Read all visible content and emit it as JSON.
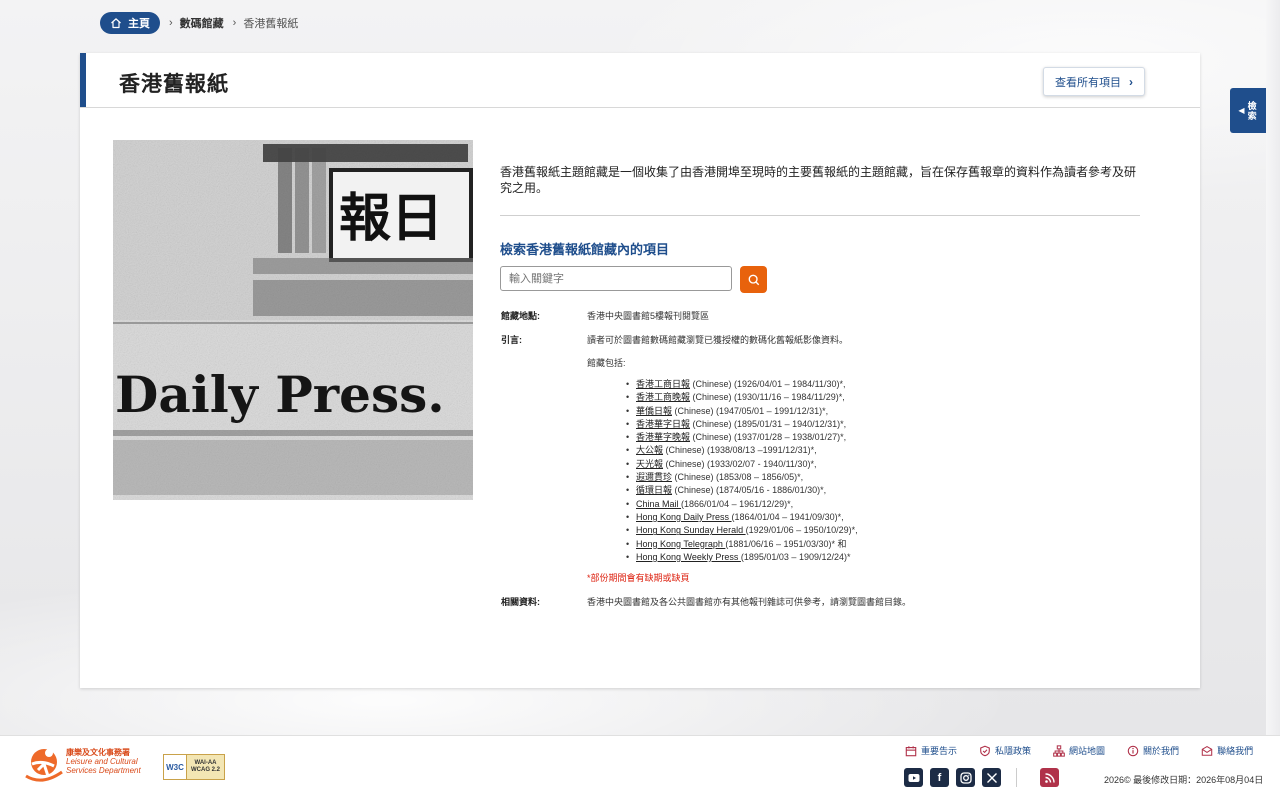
{
  "breadcrumb": {
    "home": "主頁",
    "section": "數碼館藏",
    "current": "香港舊報紙"
  },
  "header": {
    "title": "香港舊報紙",
    "view_all": "查看所有項目"
  },
  "image": {
    "masthead_top": "報日",
    "masthead_bottom": "Daily Press."
  },
  "intro": "香港舊報紙主題館藏是一個收集了由香港開埠至現時的主要舊報紙的主題館藏，旨在保存舊報章的資料作為讀者參考及研究之用。",
  "search": {
    "title": "檢索香港舊報紙館藏內的項目",
    "placeholder": "輸入關鍵字"
  },
  "info": {
    "location_label": "館藏地點:",
    "location_value": "香港中央圖書館5樓報刊閱覽區",
    "guide_label": "引言:",
    "guide_value": "讀者可於圖書館數碼館藏瀏覽已獲授權的數碼化舊報紙影像資料。",
    "includes_label": "館藏包括:",
    "items": [
      {
        "name": "香港工商日報",
        "rest": " (Chinese) (1926/04/01 – 1984/11/30)*,"
      },
      {
        "name": "香港工商晚報",
        "rest": " (Chinese) (1930/11/16 – 1984/11/29)*,"
      },
      {
        "name": "華僑日報",
        "rest": " (Chinese) (1947/05/01 – 1991/12/31)*,"
      },
      {
        "name": "香港華字日報",
        "rest": " (Chinese) (1895/01/31 – 1940/12/31)*,"
      },
      {
        "name": "香港華字晚報",
        "rest": " (Chinese) (1937/01/28 – 1938/01/27)*,"
      },
      {
        "name": "大公報",
        "rest": " (Chinese) (1938/08/13 –1991/12/31)*,"
      },
      {
        "name": "天光報",
        "rest": " (Chinese) (1933/02/07 - 1940/11/30)*,"
      },
      {
        "name": "遐邇貫珍",
        "rest": " (Chinese) (1853/08 – 1856/05)*,"
      },
      {
        "name": "循環日報",
        "rest": " (Chinese) (1874/05/16 - 1886/01/30)*,"
      },
      {
        "name": "China Mail ",
        "rest": "(1866/01/04 – 1961/12/29)*,"
      },
      {
        "name": "Hong Kong Daily Press ",
        "rest": "(1864/01/04 – 1941/09/30)*,"
      },
      {
        "name": "Hong Kong Sunday Herald ",
        "rest": "(1929/01/06 – 1950/10/29)*,"
      },
      {
        "name": "Hong Kong Telegraph ",
        "rest": "(1881/06/16 – 1951/03/30)* 和"
      },
      {
        "name": "Hong Kong Weekly Press ",
        "rest": "(1895/01/03 – 1909/12/24)*"
      }
    ],
    "note": "*部份期間會有缺期或缺頁",
    "related_label": "相關資料:",
    "related_value": "香港中央圖書館及各公共圖書館亦有其他報刊雜誌可供參考，請瀏覽圖書館目錄。"
  },
  "side_tab": "檢索",
  "footer": {
    "logo_cn": "康樂及文化事務署",
    "logo_en1": "Leisure and Cultural",
    "logo_en2": "Services Department",
    "wcag_w3c": "W3C",
    "wcag_level": "WAI-AA",
    "wcag_version": "WCAG 2.2",
    "links": [
      "重要告示",
      "私隱政策",
      "網站地圖",
      "關於我們",
      "聯絡我們"
    ],
    "social_icons": [
      "youtube-icon",
      "facebook-icon",
      "instagram-icon",
      "x-icon",
      "rss-icon"
    ],
    "copyright": "2026©  最後修改日期：2026年08月04日"
  },
  "colors": {
    "primary": "#1f4e8c",
    "accent_orange": "#e8620c",
    "note_red": "#dd1111"
  }
}
